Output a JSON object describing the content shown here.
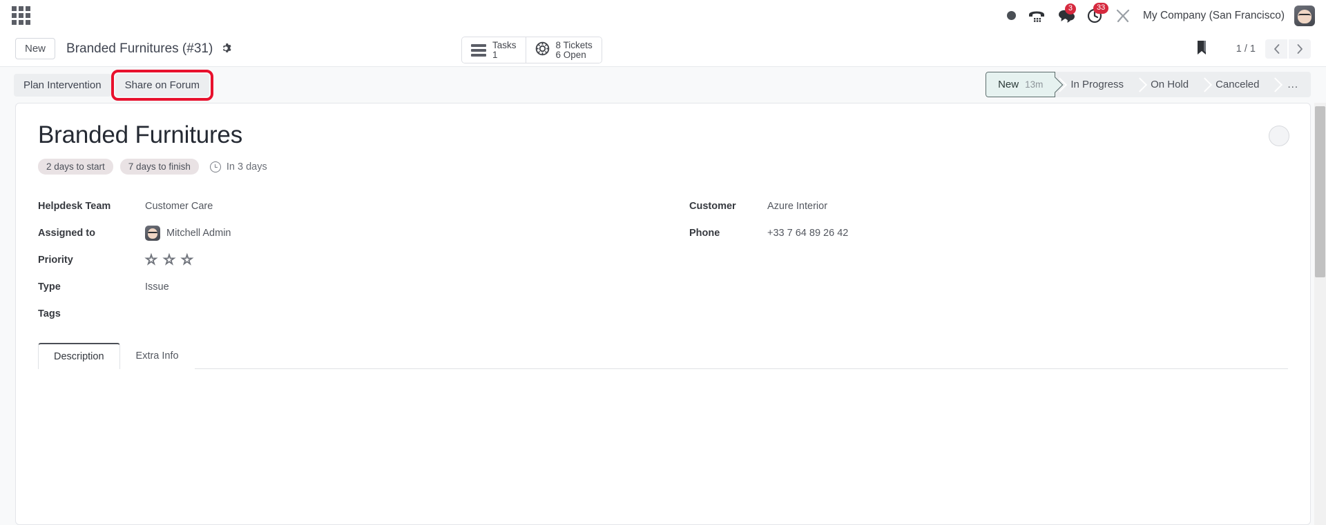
{
  "navbar": {
    "apps_icon": "apps-grid-icon",
    "icons": [
      {
        "name": "presence-dot-icon",
        "badge": null
      },
      {
        "name": "voip-phone-icon",
        "badge": null
      },
      {
        "name": "messages-icon",
        "badge": "3"
      },
      {
        "name": "activities-clock-icon",
        "badge": "33"
      },
      {
        "name": "tools-icon",
        "badge": null
      }
    ],
    "company": "My Company (San Francisco)",
    "avatar": "user-avatar"
  },
  "control_panel": {
    "new_label": "New",
    "breadcrumb_title": "Branded Furnitures (#31)",
    "gear_icon": "gear-icon",
    "stat_buttons": [
      {
        "icon": "tasks-list-icon",
        "line1": "Tasks",
        "line2": "1"
      },
      {
        "icon": "lifebuoy-ticket-icon",
        "line1": "8 Tickets",
        "line2": "6 Open"
      }
    ],
    "bookmark_icon": "bookmark-icon",
    "pager": "1 / 1",
    "prev_icon": "chevron-left-icon",
    "next_icon": "chevron-right-icon"
  },
  "action_row": {
    "buttons": [
      {
        "label": "Plan Intervention",
        "highlighted": false
      },
      {
        "label": "Share on Forum",
        "highlighted": true
      }
    ],
    "highlight_color": "#e8112d"
  },
  "statusbar": {
    "stages": [
      {
        "label": "New",
        "duration": "13m",
        "active": true
      },
      {
        "label": "In Progress",
        "duration": "",
        "active": false
      },
      {
        "label": "On Hold",
        "duration": "",
        "active": false
      },
      {
        "label": "Canceled",
        "duration": "",
        "active": false
      },
      {
        "label": "...",
        "duration": "",
        "active": false
      }
    ],
    "active_bg": "#e6f2f0"
  },
  "record": {
    "title": "Branded Furnitures",
    "pills": [
      "2 days to start",
      "7 days to finish"
    ],
    "deadline_icon": "clock-icon",
    "deadline": "In 3 days",
    "avatar_placeholder": "avatar-placeholder"
  },
  "fields_left": [
    {
      "label": "Helpdesk Team",
      "value": "Customer Care",
      "type": "text"
    },
    {
      "label": "Assigned to",
      "value": "Mitchell Admin",
      "type": "avatar"
    },
    {
      "label": "Priority",
      "value": "",
      "type": "stars",
      "stars": 3,
      "filled": 0
    },
    {
      "label": "Type",
      "value": "Issue",
      "type": "text"
    },
    {
      "label": "Tags",
      "value": "",
      "type": "text"
    }
  ],
  "fields_right": [
    {
      "label": "Customer",
      "value": "Azure Interior",
      "type": "text"
    },
    {
      "label": "Phone",
      "value": "+33 7 64 89 26 42",
      "type": "text"
    }
  ],
  "notebook": {
    "tabs": [
      {
        "label": "Description",
        "active": true
      },
      {
        "label": "Extra Info",
        "active": false
      }
    ]
  }
}
